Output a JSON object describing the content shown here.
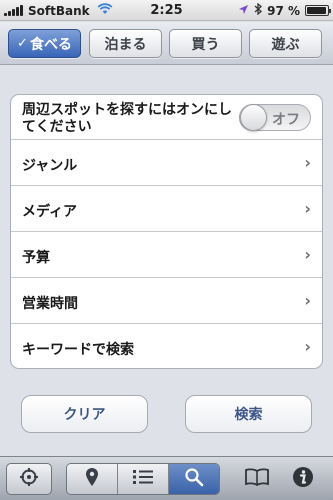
{
  "status_bar": {
    "carrier": "SoftBank",
    "time": "2:25",
    "battery": "97 %",
    "battery_level": 0.97
  },
  "top_tabs": [
    {
      "label": "食べる",
      "check": "✓",
      "active": true
    },
    {
      "label": "泊まる",
      "active": false
    },
    {
      "label": "買う",
      "active": false
    },
    {
      "label": "遊ぶ",
      "active": false
    }
  ],
  "list": {
    "toggle_row": {
      "label": "周辺スポットを探すにはオンにしてください",
      "toggle_label": "オフ",
      "toggle_on": false
    },
    "items": [
      {
        "label": "ジャンル"
      },
      {
        "label": "メディア"
      },
      {
        "label": "予算"
      },
      {
        "label": "営業時間"
      },
      {
        "label": "キーワードで検索"
      }
    ],
    "chevron": "›"
  },
  "buttons": {
    "clear_label": "クリア",
    "search_label": "検索"
  },
  "toolbar": {
    "items": [
      "location-icon",
      "map-pin-icon",
      "list-icon",
      "search-icon",
      "book-icon",
      "info-icon"
    ],
    "active": "search-icon"
  },
  "colors": {
    "accent": "#3865b8",
    "button_text": "#3d5687"
  }
}
